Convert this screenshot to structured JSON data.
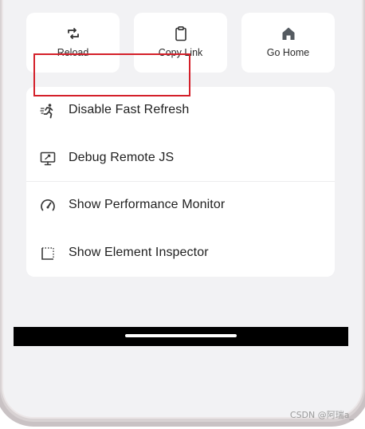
{
  "tiles": [
    {
      "label": "Reload",
      "icon": "reload-icon"
    },
    {
      "label": "Copy Link",
      "icon": "clipboard-icon"
    },
    {
      "label": "Go Home",
      "icon": "home-icon"
    }
  ],
  "menu": {
    "items": [
      {
        "label": "Disable Fast Refresh",
        "icon": "running-person-icon"
      },
      {
        "label": "Debug Remote JS",
        "icon": "monitor-debug-icon"
      },
      {
        "label": "Show Performance Monitor",
        "icon": "gauge-icon"
      },
      {
        "label": "Show Element Inspector",
        "icon": "dotted-square-icon"
      }
    ]
  },
  "highlight_color": "#d4202a",
  "watermark": "CSDN @阿瑞a_"
}
